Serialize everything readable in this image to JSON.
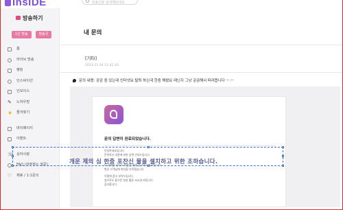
{
  "app": {
    "logo_text": "InsIDE",
    "search_placeholder": "방송인을 검색해보세요"
  },
  "sidebar": {
    "title": "방송하기",
    "buttons": [
      "1인 방송",
      "방송국"
    ],
    "items": [
      {
        "label": "홈",
        "icon": "home-icon"
      },
      {
        "label": "라이브 방송",
        "icon": "live-icon"
      },
      {
        "label": "랭킹",
        "icon": "ranking-icon"
      },
      {
        "label": "인스싸이션",
        "icon": "insight-icon"
      },
      {
        "label": "인보이스",
        "icon": "invoice-icon"
      },
      {
        "label": "노하우방",
        "icon": "pen-icon"
      },
      {
        "label": "즐겨찾기",
        "icon": "star-icon"
      },
      {
        "label": "마이페이지",
        "icon": "mypage-icon"
      },
      {
        "label": "이벤트",
        "icon": "gift-icon"
      },
      {
        "label": "상자사랑",
        "icon": "phone-icon"
      },
      {
        "label": "FAQ (자주하는 질문)",
        "icon": "faq-icon"
      },
      {
        "label": "제휴 / 1:1문의",
        "icon": "heart-icon"
      }
    ]
  },
  "main": {
    "page_title": "내 문의",
    "question": {
      "category": "[기타]",
      "date": "2023-11-24 11:41:10",
      "text": "문의 내용: 공감 중 있는데 인터넷요 탈퇴 하는데 한중 해봤요 레닌지 그냥 궁금해서 떠러봅니다 ㅡ.ㅡ"
    },
    "answer": {
      "title": "문의 답변이 완료되었습니다.",
      "lines_a": [
        "안녕하세요입니다.",
        "문의하신 내용에 대한 답변 안내드립니다."
      ],
      "lines_b": [
        "더 정확한 서비스 이용을 위해 참고하시기 바랍니다.",
        "항상 고객님께 최선을 다하겠습니다."
      ],
      "lines_c": [
        "이용에 참고 부탁드립니다.",
        "앞으로도 즐거운 방송 활동 되시길 바랍니다.",
        "감사합니다."
      ]
    },
    "selection_overlay_text": "개운 제의 심 한중 포찬신 물을 셀치하고 위한 조하습니다."
  }
}
